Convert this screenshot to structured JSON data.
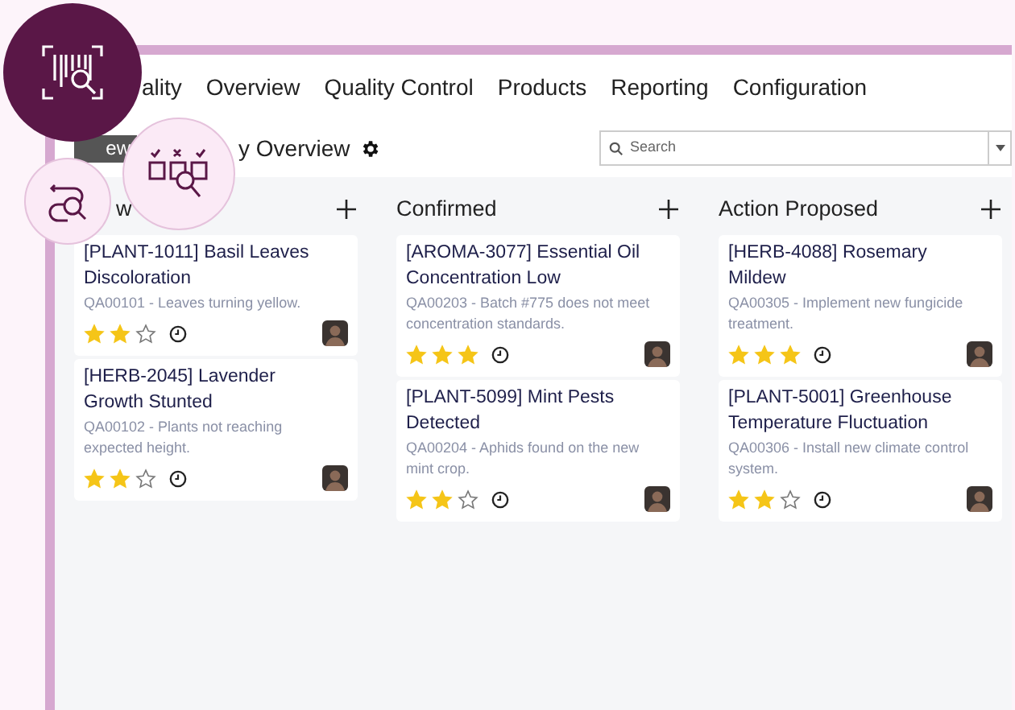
{
  "nav": {
    "brand": "ality",
    "items": [
      {
        "label": "Overview"
      },
      {
        "label": "Quality Control"
      },
      {
        "label": "Products"
      },
      {
        "label": "Reporting"
      },
      {
        "label": "Configuration"
      }
    ]
  },
  "subheader": {
    "badge": "ew",
    "title": "y Overview"
  },
  "search": {
    "placeholder": "Search"
  },
  "columns": [
    {
      "title": "w",
      "cards": [
        {
          "title": "[PLANT-1011] Basil Leaves Discoloration",
          "description": "QA00101 - Leaves turning yellow.",
          "stars": 2
        },
        {
          "title": "[HERB-2045] Lavender Growth Stunted",
          "description": "QA00102 - Plants not reaching expected height.",
          "stars": 2
        }
      ]
    },
    {
      "title": "Confirmed",
      "cards": [
        {
          "title": "[AROMA-3077] Essential Oil Concentration Low",
          "description": "QA00203 - Batch #775 does not meet concentration standards.",
          "stars": 3
        },
        {
          "title": "[PLANT-5099] Mint Pests Detected",
          "description": "QA00204 - Aphids found on the new mint crop.",
          "stars": 2
        }
      ]
    },
    {
      "title": "Action Proposed",
      "cards": [
        {
          "title": "[HERB-4088] Rosemary Mildew",
          "description": "QA00305 - Implement new fungicide treatment.",
          "stars": 3
        },
        {
          "title": "[PLANT-5001] Greenhouse Temperature Fluctuation",
          "description": "QA00306 - Install new climate control system.",
          "stars": 2
        }
      ]
    }
  ]
}
